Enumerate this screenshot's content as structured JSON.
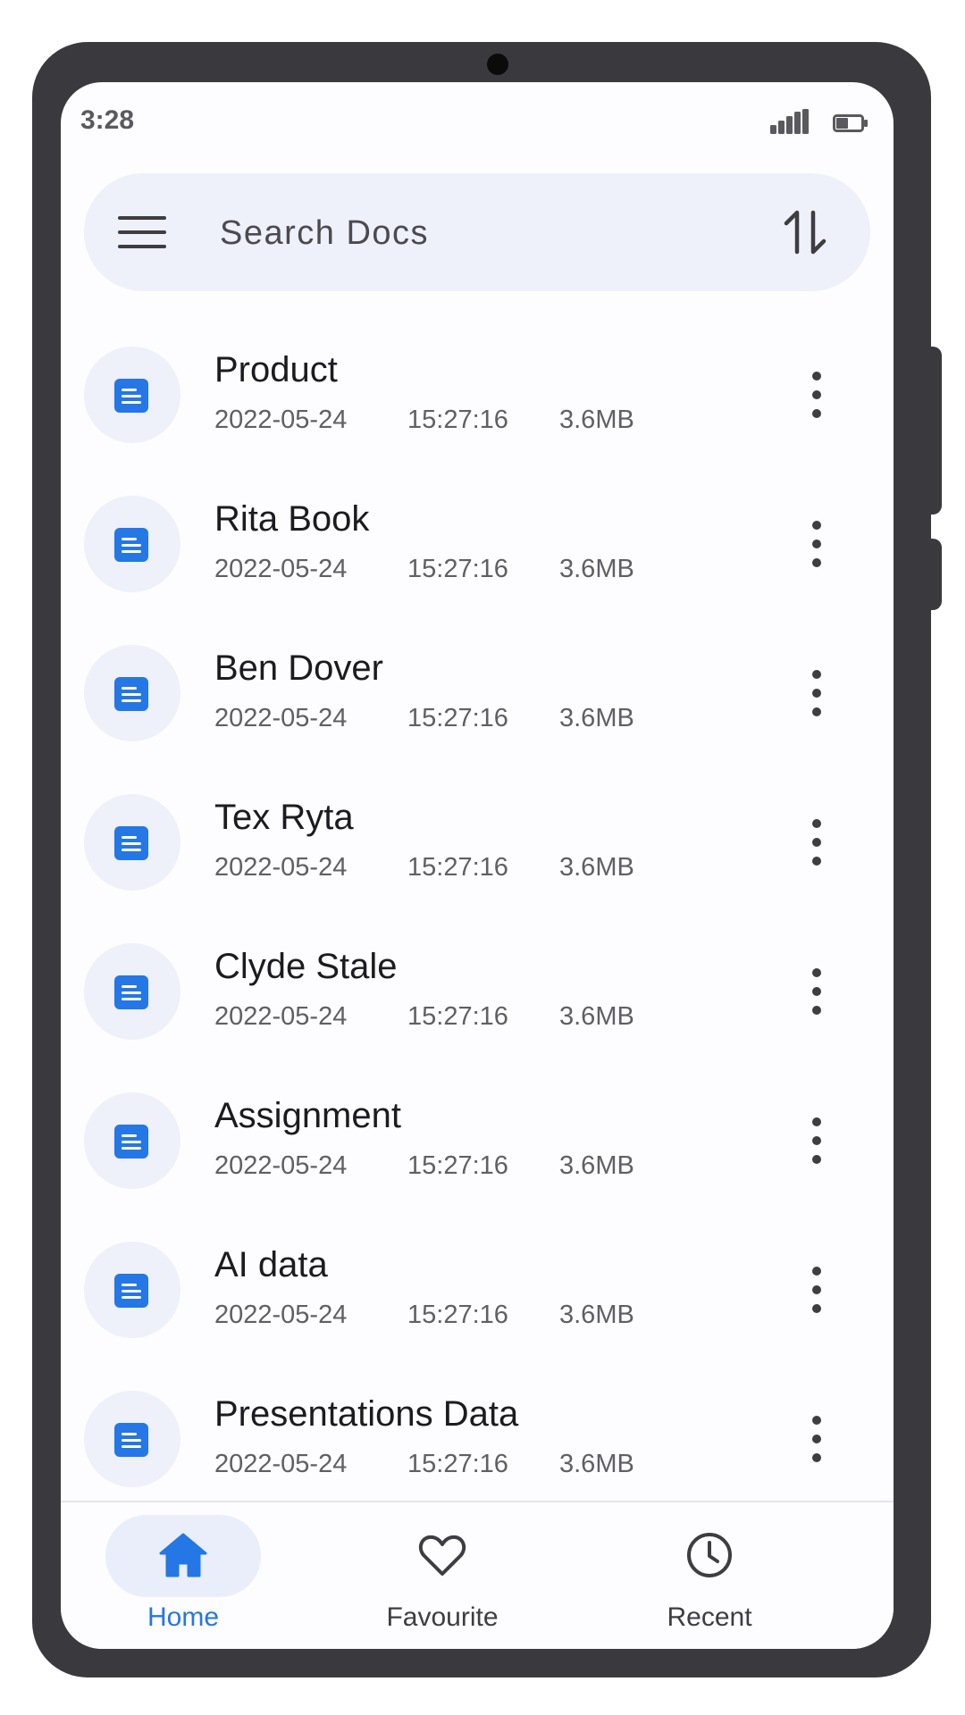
{
  "status_bar": {
    "time": "3:28",
    "icons": [
      "signal-icon",
      "battery-icon"
    ]
  },
  "search": {
    "placeholder": "Search Docs",
    "value": "",
    "menu_icon": "menu-icon",
    "sort_icon": "sort-icon"
  },
  "documents": [
    {
      "title": "Product",
      "date": "2022-05-24",
      "time": "15:27:16",
      "size": "3.6MB"
    },
    {
      "title": "Rita Book",
      "date": "2022-05-24",
      "time": "15:27:16",
      "size": "3.6MB"
    },
    {
      "title": "Ben Dover",
      "date": "2022-05-24",
      "time": "15:27:16",
      "size": "3.6MB"
    },
    {
      "title": "Tex Ryta",
      "date": "2022-05-24",
      "time": "15:27:16",
      "size": "3.6MB"
    },
    {
      "title": "Clyde Stale",
      "date": "2022-05-24",
      "time": "15:27:16",
      "size": "3.6MB"
    },
    {
      "title": "Assignment",
      "date": "2022-05-24",
      "time": "15:27:16",
      "size": "3.6MB"
    },
    {
      "title": "AI data",
      "date": "2022-05-24",
      "time": "15:27:16",
      "size": "3.6MB"
    },
    {
      "title": "Presentations Data",
      "date": "2022-05-24",
      "time": "15:27:16",
      "size": "3.6MB"
    }
  ],
  "bottom_nav": {
    "active": "home",
    "items": [
      {
        "id": "home",
        "label": "Home",
        "icon": "home-icon"
      },
      {
        "id": "favourite",
        "label": "Favourite",
        "icon": "heart-icon"
      },
      {
        "id": "recent",
        "label": "Recent",
        "icon": "clock-icon"
      }
    ]
  },
  "colors": {
    "accent": "#2477e4",
    "doc_icon": "#2477e4",
    "surface": "#eef0fa",
    "frame": "#3a393d"
  }
}
